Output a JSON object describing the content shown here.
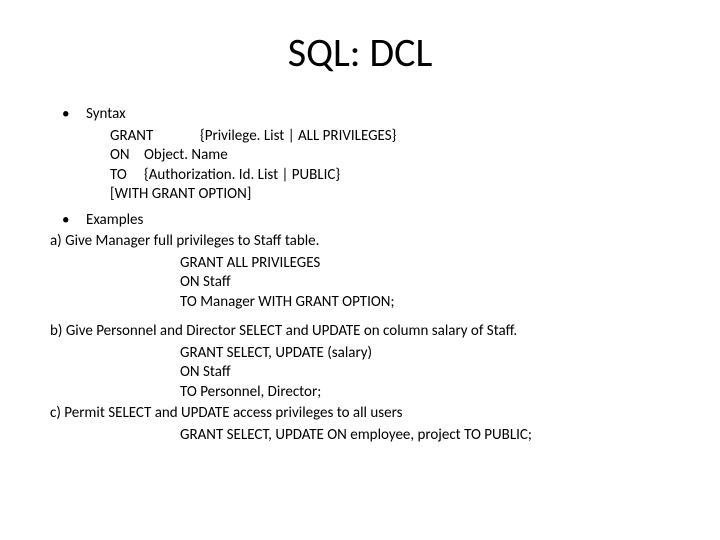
{
  "title": "SQL: DCL",
  "syntax": {
    "label": "Syntax",
    "grant_kw": "GRANT",
    "grant_args": "{Privilege. List | ALL PRIVILEGES}",
    "on_kw": "ON",
    "on_args": "Object. Name",
    "to_kw": "TO",
    "to_args": "{Authorization. Id. List | PUBLIC}",
    "with": "[WITH GRANT OPTION]"
  },
  "examples": {
    "label": "Examples",
    "a": {
      "desc": "a) Give Manager full privileges to Staff table.",
      "l1": "GRANT ALL PRIVILEGES",
      "l2": "ON Staff",
      "l3": "TO Manager WITH GRANT OPTION;"
    },
    "b": {
      "desc": "b) Give Personnel and Director SELECT and UPDATE on column salary of Staff.",
      "l1": "GRANT SELECT, UPDATE (salary)",
      "l2": "ON Staff",
      "l3": "TO Personnel, Director;"
    },
    "c": {
      "desc": "c) Permit SELECT and UPDATE access privileges to all users",
      "l1": "GRANT SELECT, UPDATE  ON employee, project TO PUBLIC;"
    }
  }
}
